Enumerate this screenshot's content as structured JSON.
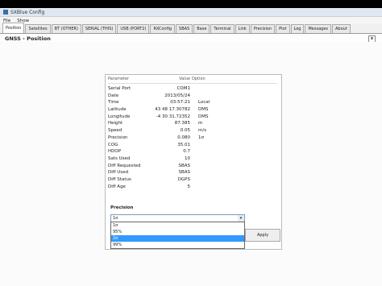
{
  "window": {
    "title": "SXBlue Config"
  },
  "menu": [
    "File",
    "Show"
  ],
  "tabs": [
    {
      "label": "Position",
      "active": true
    },
    {
      "label": "Satellites"
    },
    {
      "label": "BT (OTHER)"
    },
    {
      "label": "SERIAL (THIS)"
    },
    {
      "label": "USB (PORT2)"
    },
    {
      "label": "RXConfig"
    },
    {
      "label": "SBAS"
    },
    {
      "label": "Base"
    },
    {
      "label": "Terminal"
    },
    {
      "label": "Link"
    },
    {
      "label": "Precision"
    },
    {
      "label": "Plot"
    },
    {
      "label": "Log"
    },
    {
      "label": "Messages"
    },
    {
      "label": "About"
    }
  ],
  "section": {
    "title": "GNSS - Position",
    "close_label": "x"
  },
  "table": {
    "headers": {
      "param": "Parameter",
      "value": "Value",
      "option": "Option"
    },
    "rows": [
      {
        "param": "Serial Port",
        "value": "COM1",
        "unit": ""
      },
      {
        "param": "Date",
        "value": "2013/05/24",
        "unit": ""
      },
      {
        "param": "Time",
        "value": "03:57:21",
        "unit": "Local"
      },
      {
        "param": "Latitude",
        "value": "43 48 17.30782",
        "unit": "DMS"
      },
      {
        "param": "Longitude",
        "value": "-4 30 31.72352",
        "unit": "DMS"
      },
      {
        "param": "Height",
        "value": "87.385",
        "unit": "m"
      },
      {
        "param": "Speed",
        "value": "0.05",
        "unit": "m/s"
      },
      {
        "param": "Precision",
        "value": "0.080",
        "unit": "1σ"
      },
      {
        "param": "COG",
        "value": "35.01",
        "unit": ""
      },
      {
        "param": "HDOP",
        "value": "0.7",
        "unit": ""
      },
      {
        "param": "Sats Used",
        "value": "10",
        "unit": ""
      },
      {
        "param": "Diff Requested",
        "value": "SBAS",
        "unit": ""
      },
      {
        "param": "Diff Used",
        "value": "SBAS",
        "unit": ""
      },
      {
        "param": "Diff Status",
        "value": "DGPS",
        "unit": ""
      },
      {
        "param": "Diff Age",
        "value": "5",
        "unit": ""
      }
    ]
  },
  "precision": {
    "label": "Precision",
    "selected": "1σ",
    "options": [
      "1σ",
      "95%",
      "2σ",
      "99%"
    ],
    "highlighted_index": 2
  },
  "apply_label": "Apply"
}
